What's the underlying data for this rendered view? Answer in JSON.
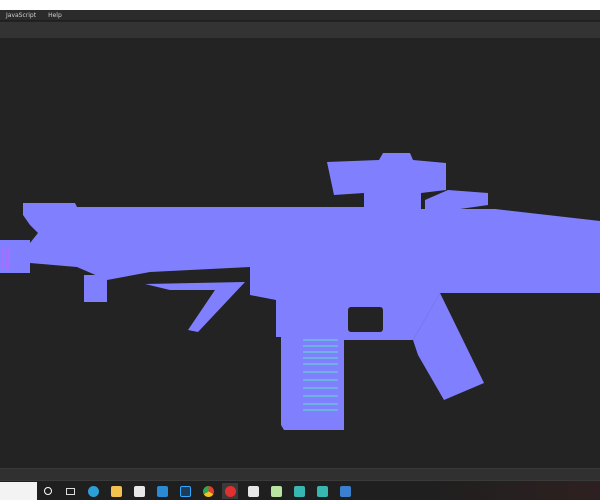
{
  "menubar": {
    "items": [
      "JavaScript",
      "Help"
    ]
  },
  "colors": {
    "normal_map": "#8080ff",
    "background": "#232323"
  },
  "taskbar": {
    "apps": [
      {
        "name": "cortana",
        "color": "#ffffff"
      },
      {
        "name": "task-view",
        "color": "#dddddd"
      },
      {
        "name": "edge",
        "color": "#2b9fd8"
      },
      {
        "name": "file-explorer",
        "color": "#f2c14e"
      },
      {
        "name": "microsoft-store",
        "color": "#e8e8e8"
      },
      {
        "name": "mail",
        "color": "#2a8ad4"
      },
      {
        "name": "photoshop",
        "color": "#1f3b58"
      },
      {
        "name": "chrome",
        "color": "#e0412f"
      },
      {
        "name": "substance-painter",
        "color": "#e03030"
      },
      {
        "name": "app-figure",
        "color": "#e6e6e6"
      },
      {
        "name": "app-tree",
        "color": "#b9e3a0"
      },
      {
        "name": "maya-1",
        "color": "#38b6b0"
      },
      {
        "name": "maya-2",
        "color": "#38b6b0"
      },
      {
        "name": "photos",
        "color": "#3b7fd1"
      }
    ]
  }
}
